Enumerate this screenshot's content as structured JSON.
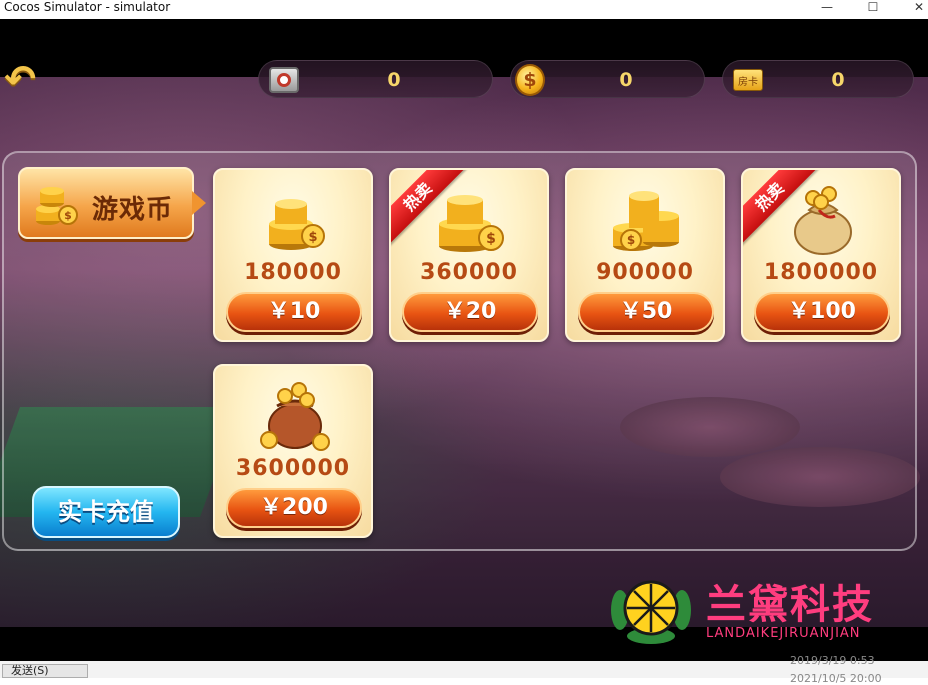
{
  "window": {
    "title": "Cocos Simulator - simulator",
    "minimize": "—",
    "maximize": "☐",
    "close": "✕"
  },
  "resources": [
    {
      "icon": "ticket-icon",
      "value": "0"
    },
    {
      "icon": "gold-coin-icon",
      "value": "0",
      "symbol": "$"
    },
    {
      "icon": "room-card-icon",
      "value": "0",
      "label": "房卡"
    }
  ],
  "category": {
    "label": "游戏币"
  },
  "shop_items": [
    {
      "amount": "180000",
      "price": "￥10",
      "hot": false,
      "art": "coin-stack"
    },
    {
      "amount": "360000",
      "price": "￥20",
      "hot": true,
      "art": "coin-stack"
    },
    {
      "amount": "900000",
      "price": "￥50",
      "hot": false,
      "art": "coin-stack"
    },
    {
      "amount": "1800000",
      "price": "￥100",
      "hot": true,
      "art": "money-bag"
    },
    {
      "amount": "3600000",
      "price": "￥200",
      "hot": false,
      "art": "treasure-bag"
    }
  ],
  "hot_label": "热卖",
  "recharge_button": "实卡充值",
  "watermark": {
    "title": "兰黛科技",
    "subtitle": "LANDAIKEJIRUANJIAN"
  },
  "taskbar": {
    "button": "发送(S)",
    "date1": "2019/3/19 0:53",
    "date2": "2021/10/5 20:00"
  },
  "colors": {
    "accent_gold": "#f6d66a",
    "price_orange": "#e85412",
    "hot_red": "#c40e0e",
    "recharge_blue": "#24b6f0",
    "watermark_pink": "#ff3d7f"
  }
}
